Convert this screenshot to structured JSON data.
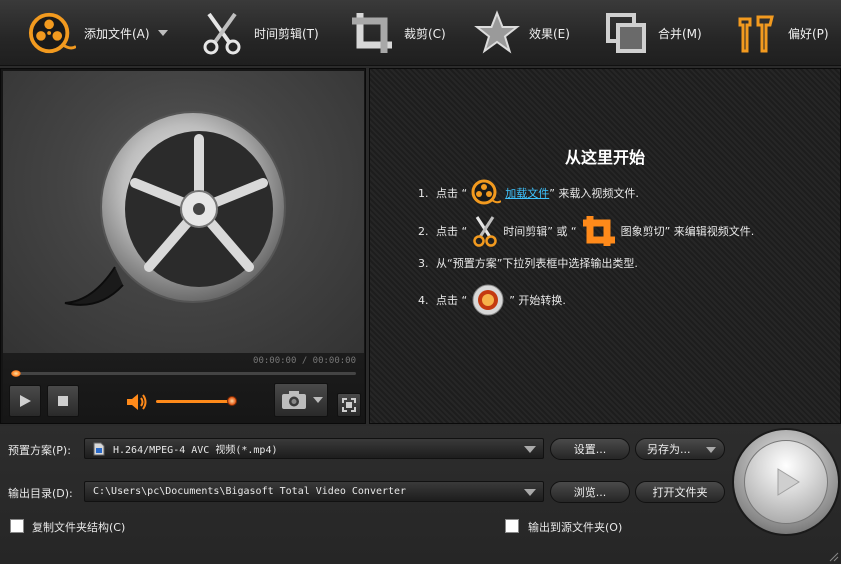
{
  "toolbar": {
    "add_file": "添加文件(A)",
    "trim": "时间剪辑(T)",
    "crop": "裁剪(C)",
    "effect": "效果(E)",
    "merge": "合并(M)",
    "prefs": "偏好(P)"
  },
  "player": {
    "time": "00:00:00 / 00:00:00",
    "volume_fraction": 0.95
  },
  "guide": {
    "title": "从这里开始",
    "step1": {
      "num": "1.",
      "pre": "点击 “",
      "link": "加载文件",
      "post": "” 来载入视频文件."
    },
    "step2": {
      "num": "2.",
      "pre": "点击 “",
      "mid1": "时间剪辑” 或 “",
      "mid2": "图象剪切” 来编辑视频文件."
    },
    "step3": {
      "num": "3.",
      "text": "从“预置方案”下拉列表框中选择输出类型."
    },
    "step4": {
      "num": "4.",
      "pre": "点击 “",
      "post": "” 开始转换."
    }
  },
  "output": {
    "preset_label": "预置方案(P):",
    "preset_value": "H.264/MPEG-4 AVC 视频(*.mp4)",
    "settings_button": "设置...",
    "save_as_button": "另存为...",
    "dir_label": "输出目录(D):",
    "dir_value": "C:\\Users\\pc\\Documents\\Bigasoft Total Video Converter",
    "browse_button": "浏览...",
    "open_folder_button": "打开文件夹",
    "copy_structure_label": "复制文件夹结构(C)",
    "output_to_source_label": "输出到源文件夹(O)"
  },
  "colors": {
    "accent_orange": "#ff8a1a",
    "link_blue": "#3ec4ff"
  },
  "icons": {
    "add_file": "film-reel-icon",
    "trim": "scissors-icon",
    "crop": "crop-icon",
    "effect": "star-icon",
    "merge": "merge-icon",
    "prefs": "tools-icon"
  }
}
